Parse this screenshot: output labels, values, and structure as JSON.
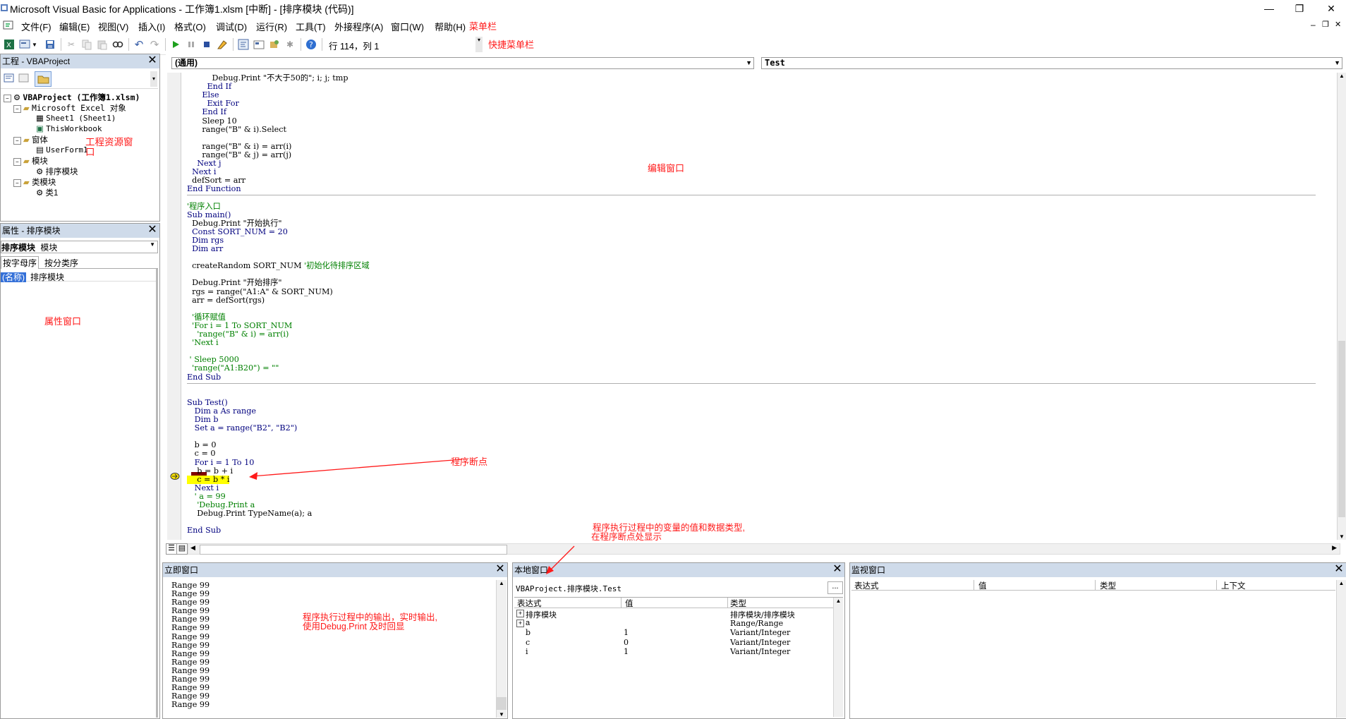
{
  "window": {
    "title": "Microsoft Visual Basic for Applications - 工作簿1.xlsm [中断] - [排序模块 (代码)]",
    "minimize": "—",
    "restore": "❐",
    "close": "✕",
    "inner_minimize": "–",
    "inner_restore": "❐",
    "inner_close": "✕"
  },
  "menu": {
    "items": [
      "文件(F)",
      "编辑(E)",
      "视图(V)",
      "插入(I)",
      "格式(O)",
      "调试(D)",
      "运行(R)",
      "工具(T)",
      "外接程序(A)",
      "窗口(W)",
      "帮助(H)"
    ],
    "annotation": "菜单栏"
  },
  "toolbar": {
    "position": "行 114，列 1",
    "annotation": "快捷菜单栏"
  },
  "project": {
    "title": "工程 - VBAProject",
    "tree": [
      "VBAProject (工作簿1.xlsm)",
      "Microsoft Excel 对象",
      "Sheet1 (Sheet1)",
      "ThisWorkbook",
      "窗体",
      "UserForm1",
      "模块",
      "排序模块",
      "类模块",
      "类1"
    ],
    "annotation": "工程资源窗口"
  },
  "properties": {
    "title": "属性 - 排序模块",
    "object_name": "排序模块",
    "object_type": "模块",
    "tabs": [
      "按字母序",
      "按分类序"
    ],
    "prop_name": "(名称)",
    "prop_value": "排序模块",
    "annotation": "属性窗口"
  },
  "code": {
    "object_combo": "(通用)",
    "proc_combo": "Test",
    "annotation_editor": "编辑窗口",
    "annotation_breakpoint": "程序断点",
    "annotation_locals_1": "程序执行过程中的变量的值和数据类型,",
    "annotation_locals_2": "在程序断点处显示"
  },
  "code_lines": [
    {
      "t": "          Debug.Print \"不大于50的\"; i; j; tmp",
      "k": "n"
    },
    {
      "t": "        End If",
      "k": "k"
    },
    {
      "t": "      Else",
      "k": "k"
    },
    {
      "t": "        Exit For",
      "k": "k"
    },
    {
      "t": "      End If",
      "k": "k"
    },
    {
      "t": "      Sleep 10",
      "k": "n"
    },
    {
      "t": "      range(\"B\" & i).Select",
      "k": "n"
    },
    {
      "t": "",
      "k": "n"
    },
    {
      "t": "      range(\"B\" & i) = arr(i)",
      "k": "n"
    },
    {
      "t": "      range(\"B\" & j) = arr(j)",
      "k": "n"
    },
    {
      "t": "    Next j",
      "k": "k"
    },
    {
      "t": "  Next i",
      "k": "k"
    },
    {
      "t": "  defSort = arr",
      "k": "n"
    },
    {
      "t": "End Function",
      "k": "k",
      "sep": true
    },
    {
      "t": "",
      "k": "n"
    },
    {
      "t": "'程序入口",
      "k": "c"
    },
    {
      "t": "Sub main()",
      "k": "k"
    },
    {
      "t": "  Debug.Print \"开始执行\"",
      "k": "n"
    },
    {
      "t": "  Const SORT_NUM = 20",
      "k": "k"
    },
    {
      "t": "  Dim rgs",
      "k": "k"
    },
    {
      "t": "  Dim arr",
      "k": "k"
    },
    {
      "t": "",
      "k": "n"
    },
    {
      "t": "  createRandom SORT_NUM '初始化待排序区域",
      "k": "m"
    },
    {
      "t": "",
      "k": "n"
    },
    {
      "t": "  Debug.Print \"开始排序\"",
      "k": "n"
    },
    {
      "t": "  rgs = range(\"A1:A\" & SORT_NUM)",
      "k": "n"
    },
    {
      "t": "  arr = defSort(rgs)",
      "k": "n"
    },
    {
      "t": "",
      "k": "n"
    },
    {
      "t": "  '循环赋值",
      "k": "c"
    },
    {
      "t": "  'For i = 1 To SORT_NUM",
      "k": "c"
    },
    {
      "t": "    'range(\"B\" & i) = arr(i)",
      "k": "c"
    },
    {
      "t": "  'Next i",
      "k": "c"
    },
    {
      "t": "",
      "k": "n"
    },
    {
      "t": " ' Sleep 5000",
      "k": "c"
    },
    {
      "t": "  'range(\"A1:B20\") = \"\"",
      "k": "c"
    },
    {
      "t": "End Sub",
      "k": "k",
      "sep": true
    },
    {
      "t": "",
      "k": "n"
    },
    {
      "t": "",
      "k": "n"
    },
    {
      "t": "Sub Test()",
      "k": "k"
    },
    {
      "t": "   Dim a As range",
      "k": "k"
    },
    {
      "t": "   Dim b",
      "k": "k"
    },
    {
      "t": "   Set a = range(\"B2\", \"B2\")",
      "k": "k"
    },
    {
      "t": "",
      "k": "n"
    },
    {
      "t": "   b = 0",
      "k": "n"
    },
    {
      "t": "   c = 0",
      "k": "n"
    },
    {
      "t": "   For i = 1 To 10",
      "k": "k"
    },
    {
      "t": "    b = b + i",
      "k": "n"
    },
    {
      "t": "    c = b * i",
      "k": "h"
    },
    {
      "t": "   Next i",
      "k": "k"
    },
    {
      "t": "   ' a = 99",
      "k": "c"
    },
    {
      "t": "    'Debug.Print a",
      "k": "c"
    },
    {
      "t": "    Debug.Print TypeName(a); a",
      "k": "n"
    },
    {
      "t": "",
      "k": "n"
    },
    {
      "t": "End Sub",
      "k": "k"
    }
  ],
  "immediate": {
    "title": "立即窗口",
    "lines": [
      "Range 99",
      "Range 99",
      "Range 99",
      "Range 99",
      "Range 99",
      "Range 99",
      "Range 99",
      "Range 99",
      "Range 99",
      "Range 99",
      "Range 99",
      "Range 99",
      "Range 99",
      "Range 99",
      "Range 99"
    ],
    "annotation_1": "程序执行过程中的输出，实时输出,",
    "annotation_2": "使用Debug.Print 及时回显"
  },
  "locals": {
    "title": "本地窗口",
    "context": "VBAProject.排序模块.Test",
    "ellipsis": "...",
    "headers": [
      "表达式",
      "值",
      "类型"
    ],
    "rows": [
      {
        "exp": "排序模块",
        "val": "",
        "type": "排序模块/排序模块",
        "expand": "+"
      },
      {
        "exp": "a",
        "val": "",
        "type": "Range/Range",
        "expand": "+"
      },
      {
        "exp": "b",
        "val": "1",
        "type": "Variant/Integer",
        "expand": ""
      },
      {
        "exp": "c",
        "val": "0",
        "type": "Variant/Integer",
        "expand": ""
      },
      {
        "exp": "i",
        "val": "1",
        "type": "Variant/Integer",
        "expand": ""
      }
    ]
  },
  "watch": {
    "title": "监视窗口",
    "headers": [
      "表达式",
      "值",
      "类型",
      "上下文"
    ]
  },
  "icons": [
    "excel-icon",
    "insert-userform-icon",
    "save-icon",
    "cut-icon",
    "copy-icon",
    "paste-icon",
    "find-icon",
    "undo-icon",
    "redo-icon",
    "run-icon",
    "break-icon",
    "reset-icon",
    "design-mode-icon",
    "project-explorer-icon",
    "properties-window-icon",
    "object-browser-icon",
    "toolbox-icon",
    "help-icon"
  ],
  "colors": {
    "annotation": "#ff1a1a",
    "keyword": "#00007f",
    "comment": "#008000",
    "highlight": "#ffff00",
    "breakpoint": "#800000",
    "pane_header": "#cfdbea"
  }
}
